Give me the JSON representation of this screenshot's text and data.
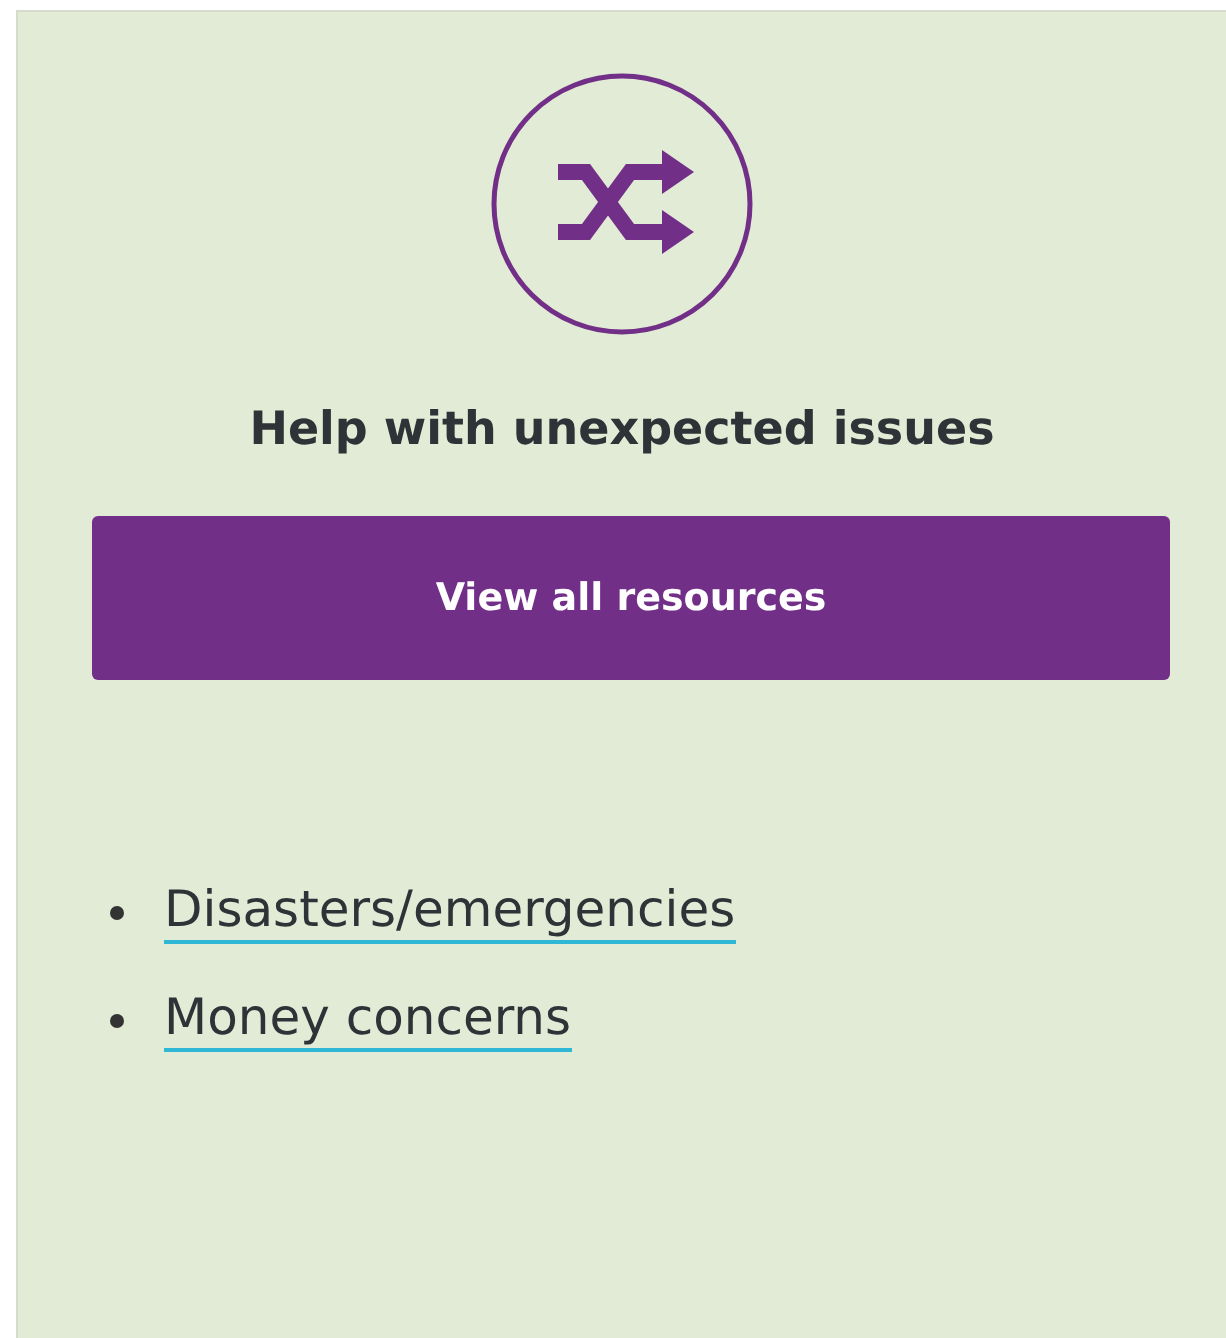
{
  "card": {
    "title": "Help with unexpected issues",
    "button": "View all resources",
    "links": [
      {
        "label": "Disasters/emergencies"
      },
      {
        "label": "Money concerns"
      }
    ]
  }
}
